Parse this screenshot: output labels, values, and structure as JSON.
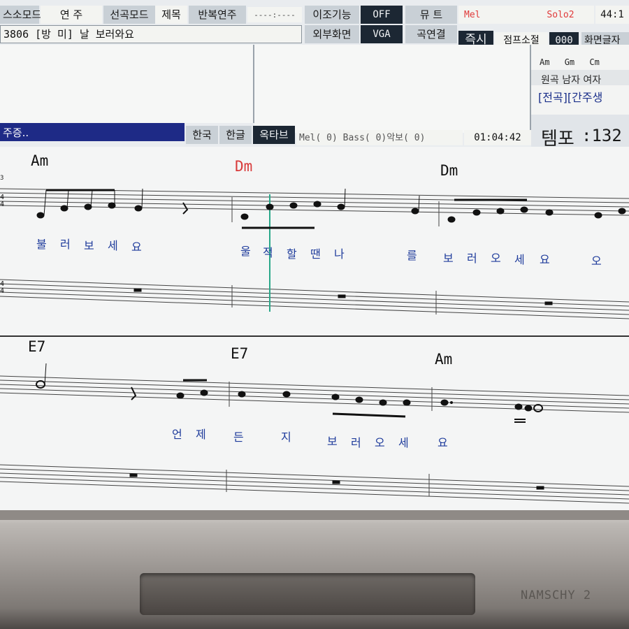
{
  "menu": {
    "mode": "스소모드",
    "play": "연   주",
    "select_mode": "선곡모드",
    "title_tab": "제목",
    "repeat": "반복연주",
    "repeat_value": "----:----",
    "transpose": "이조기능",
    "transpose_value": "OFF",
    "mute": "뮤  트",
    "mel": "Mel",
    "solo": "Solo2",
    "clock": "44:1",
    "external": "외부화면",
    "external_value": "VGA",
    "song_link": "곡연결",
    "instant": "즉시",
    "jump": "점프소절",
    "jump_value": "000",
    "screen_lyrics": "화면글자"
  },
  "song": {
    "title": "3806 [방  미] 날 보러와요"
  },
  "right_panel": {
    "chords": [
      "Am",
      "Gm",
      "Cm"
    ],
    "keys": "원곡  남자  여자",
    "section": "[전곡][간주생"
  },
  "status": {
    "playing": "주증..",
    "lang1": "한국",
    "lang2": "한글",
    "octave": "옥타브",
    "channels": "Mel( 0) Bass( 0)악보( 0)",
    "time": "01:04:42",
    "tempo_label": "템포",
    "tempo_value": ":132"
  },
  "score": {
    "row1_chords": [
      "Am",
      "Dm",
      "Dm"
    ],
    "row1_lyrics": [
      "불",
      "러",
      "보",
      "세",
      "요",
      "울",
      "적",
      "할",
      "땐",
      "나",
      "를",
      "보",
      "러",
      "오",
      "세",
      "요",
      "오"
    ],
    "row2_chords": [
      "E7",
      "E7",
      "Am"
    ],
    "row2_lyrics": [
      "언",
      "제",
      "든",
      "지",
      "보",
      "러",
      "오",
      "세",
      "요"
    ],
    "time_sig_top": "4",
    "time_sig_bottom": "4",
    "time_sig_small": "3"
  },
  "bezel": {
    "brand": "NAMSCHY 2"
  }
}
